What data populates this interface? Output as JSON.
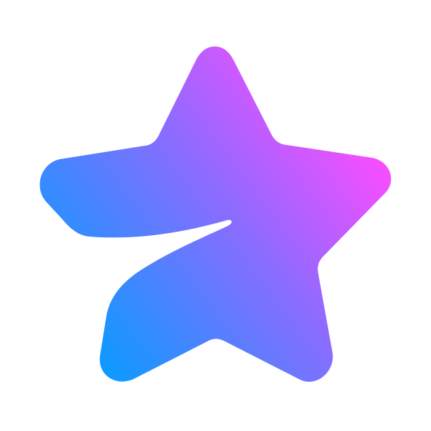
{
  "icon": {
    "name": "gradient-star-icon",
    "colors": {
      "gradient_start": "#0A9BFF",
      "gradient_mid": "#8A6CFF",
      "gradient_end": "#FF4BFF",
      "background": "#FFFFFF"
    }
  }
}
